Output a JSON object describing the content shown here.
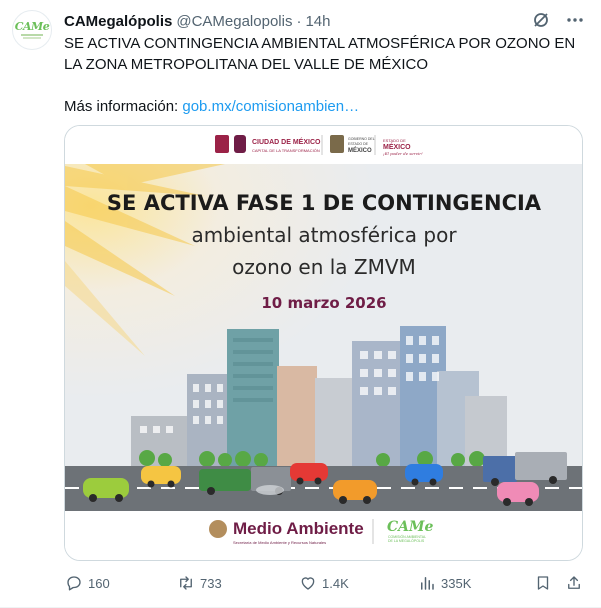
{
  "tweet": {
    "author_name": "CAMegalópolis",
    "handle": "@CAMegalopolis",
    "separator": "·",
    "time": "14h",
    "avatar_text": "CAMe",
    "text_line1": "SE ACTIVA CONTINGENCIA AMBIENTAL ATMOSFÉRICA POR OZONO EN LA ZONA METROPOLITANA DEL VALLE DE MÉXICO",
    "more_info_label": "Más información: ",
    "more_info_link": "gob.mx/comisionambien…"
  },
  "media": {
    "top_logos": [
      "CIUDAD DE MÉXICO",
      "CAPITAL DE LA TRANSFORMACIÓN",
      "GOBIERNO DEL",
      "ESTADO DE",
      "MÉXICO",
      "ESTADO DE",
      "MÉXICO",
      "¡El poder de servir!"
    ],
    "headline": "SE ACTIVA FASE 1 DE CONTINGENCIA",
    "subhead1": "ambiental atmosférica por",
    "subhead2": "ozono en la ZMVM",
    "date": "10 marzo 2026",
    "footer_brand": "Medio Ambiente",
    "footer_sub": "Secretaría de Medio Ambiente y Recursos Naturales",
    "footer_logo2": "CAMe",
    "footer_logo2_sub1": "COMISIÓN AMBIENTAL",
    "footer_logo2_sub2": "DE LA MEGALÓPOLIS",
    "colors": {
      "headline": "#1b1b1b",
      "date": "#6f1d46",
      "brand": "#6f1d46",
      "came_green": "#6bbf59",
      "sky": "#eef0f2",
      "sun": "#f6c94c"
    }
  },
  "actions": {
    "reply_count": "160",
    "retweet_count": "733",
    "like_count": "1.4K",
    "views_count": "335K"
  },
  "icons": [
    "reply-icon",
    "retweet-icon",
    "like-icon",
    "views-icon",
    "bookmark-icon",
    "share-icon",
    "grok-icon",
    "more-icon"
  ]
}
